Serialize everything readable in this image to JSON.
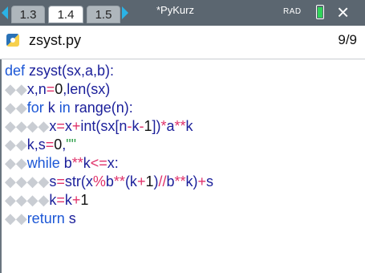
{
  "header": {
    "tabs": [
      {
        "label": "1.3"
      },
      {
        "label": "1.4"
      },
      {
        "label": "1.5"
      }
    ],
    "active_tab": "1.4",
    "document_title": "*PyKurz",
    "angle_mode": "RAD",
    "battery_level": 0.75,
    "colors": {
      "bar": "#5b6670",
      "accent": "#2bb3e6",
      "battery": "#31d35a"
    }
  },
  "file": {
    "name": "zsyst.py",
    "line_position": "9/9"
  },
  "code": [
    "def zsyst(sx,a,b):",
    "x,n=0,len(sx)",
    "for k in range(n):",
    "x=x+int(sx[n-k-1])*a**k",
    "k,s=0,\"\"",
    "while b**k<=x:",
    "s=str(x%b**(k+1)//b**k)+s",
    "k=k+1",
    "return s"
  ]
}
